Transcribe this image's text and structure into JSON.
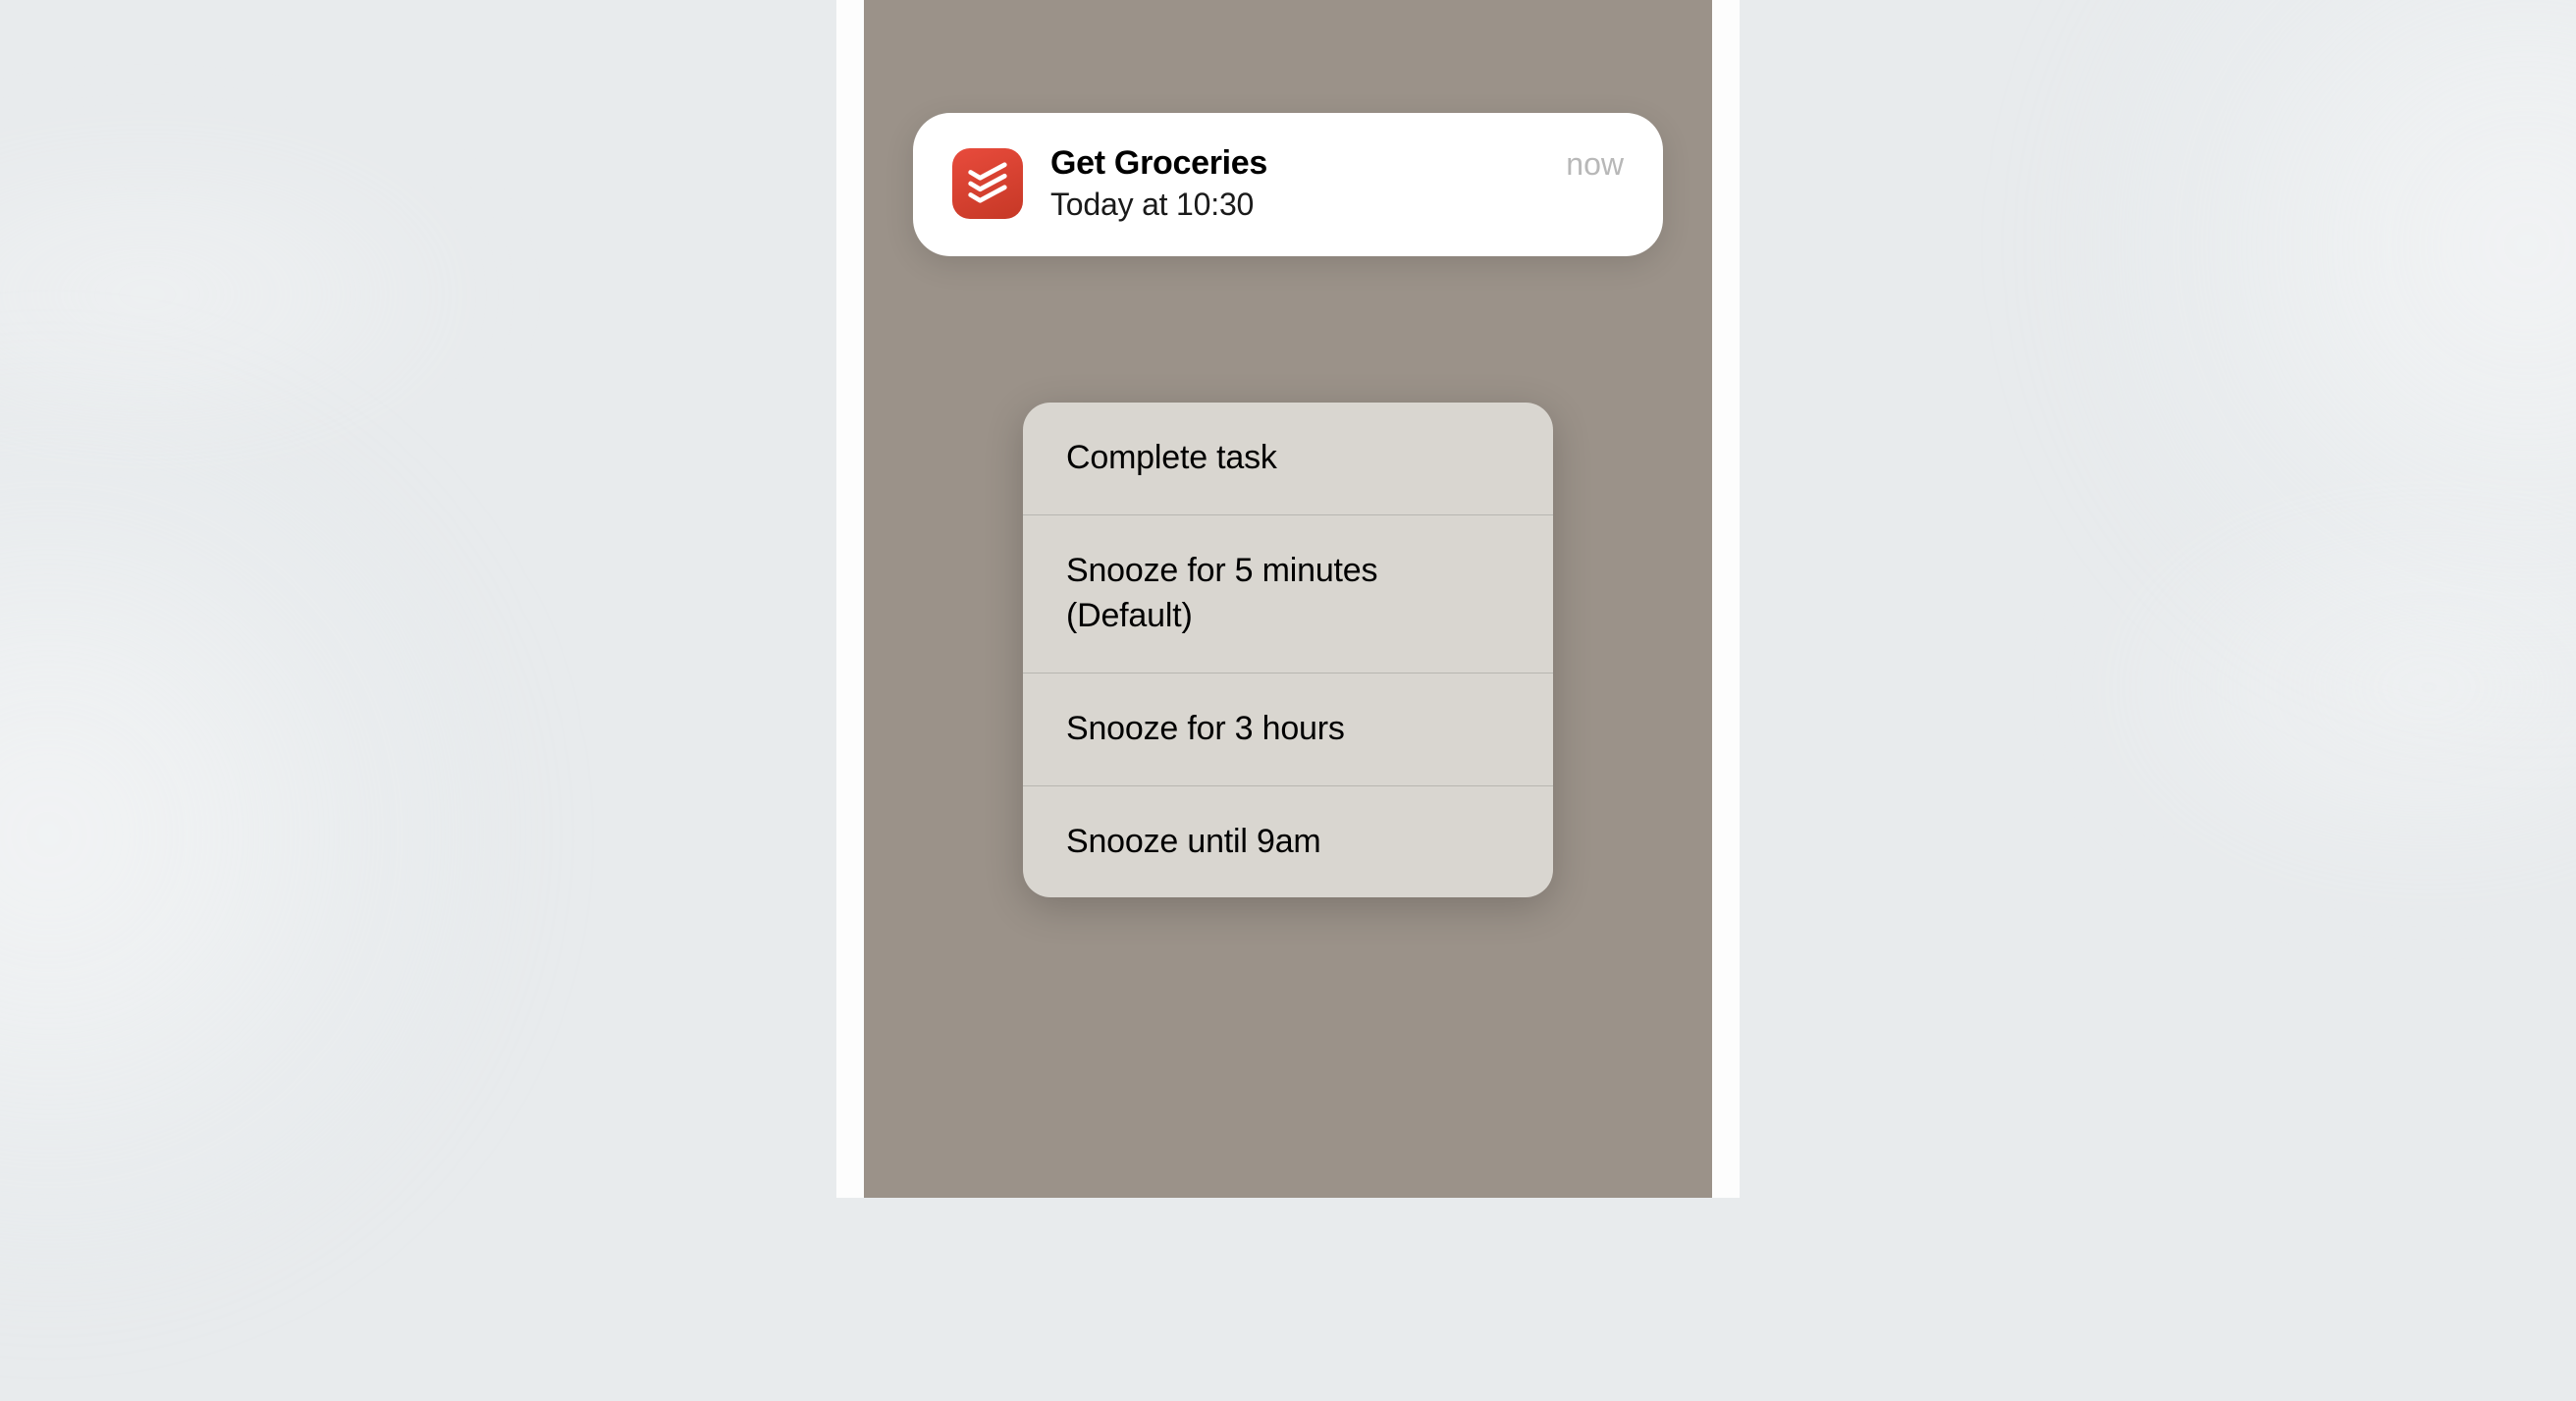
{
  "notification": {
    "title": "Get Groceries",
    "subtitle": "Today at 10:30",
    "timestamp": "now",
    "app_icon": "todoist-icon"
  },
  "actions": {
    "items": [
      {
        "label": "Complete task"
      },
      {
        "label": "Snooze for 5 minutes (Default)"
      },
      {
        "label": "Snooze for 3 hours"
      },
      {
        "label": "Snooze until 9am"
      }
    ]
  }
}
